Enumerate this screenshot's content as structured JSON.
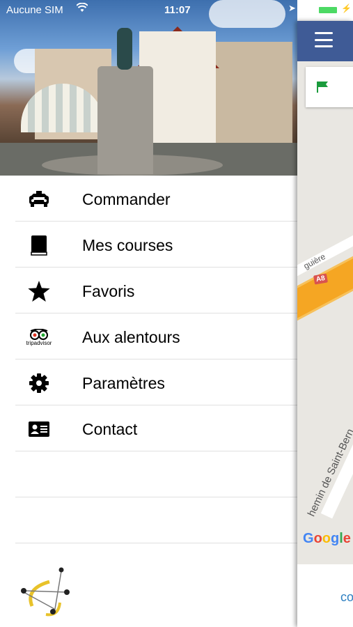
{
  "status_bar": {
    "carrier": "Aucune SIM",
    "time": "11:07",
    "battery_level": 1.0
  },
  "menu": {
    "items": [
      {
        "label": "Commander",
        "icon": "taxi-icon"
      },
      {
        "label": "Mes courses",
        "icon": "book-icon"
      },
      {
        "label": "Favoris",
        "icon": "star-icon"
      },
      {
        "label": "Aux alentours",
        "icon": "tripadvisor-icon",
        "icon_text": "tripadvisor"
      },
      {
        "label": "Paramètres",
        "icon": "gear-icon"
      },
      {
        "label": "Contact",
        "icon": "contact-card-icon"
      }
    ]
  },
  "map": {
    "road_badge": "A8",
    "street_1": "guière",
    "street_2": "hemin de Saint-Bern",
    "attribution": "Google",
    "bottom_text": "co"
  },
  "colors": {
    "topbar": "#3f5b96",
    "road": "#f5a623",
    "flag": "#1a9b3c",
    "link": "#2d7fc1"
  }
}
